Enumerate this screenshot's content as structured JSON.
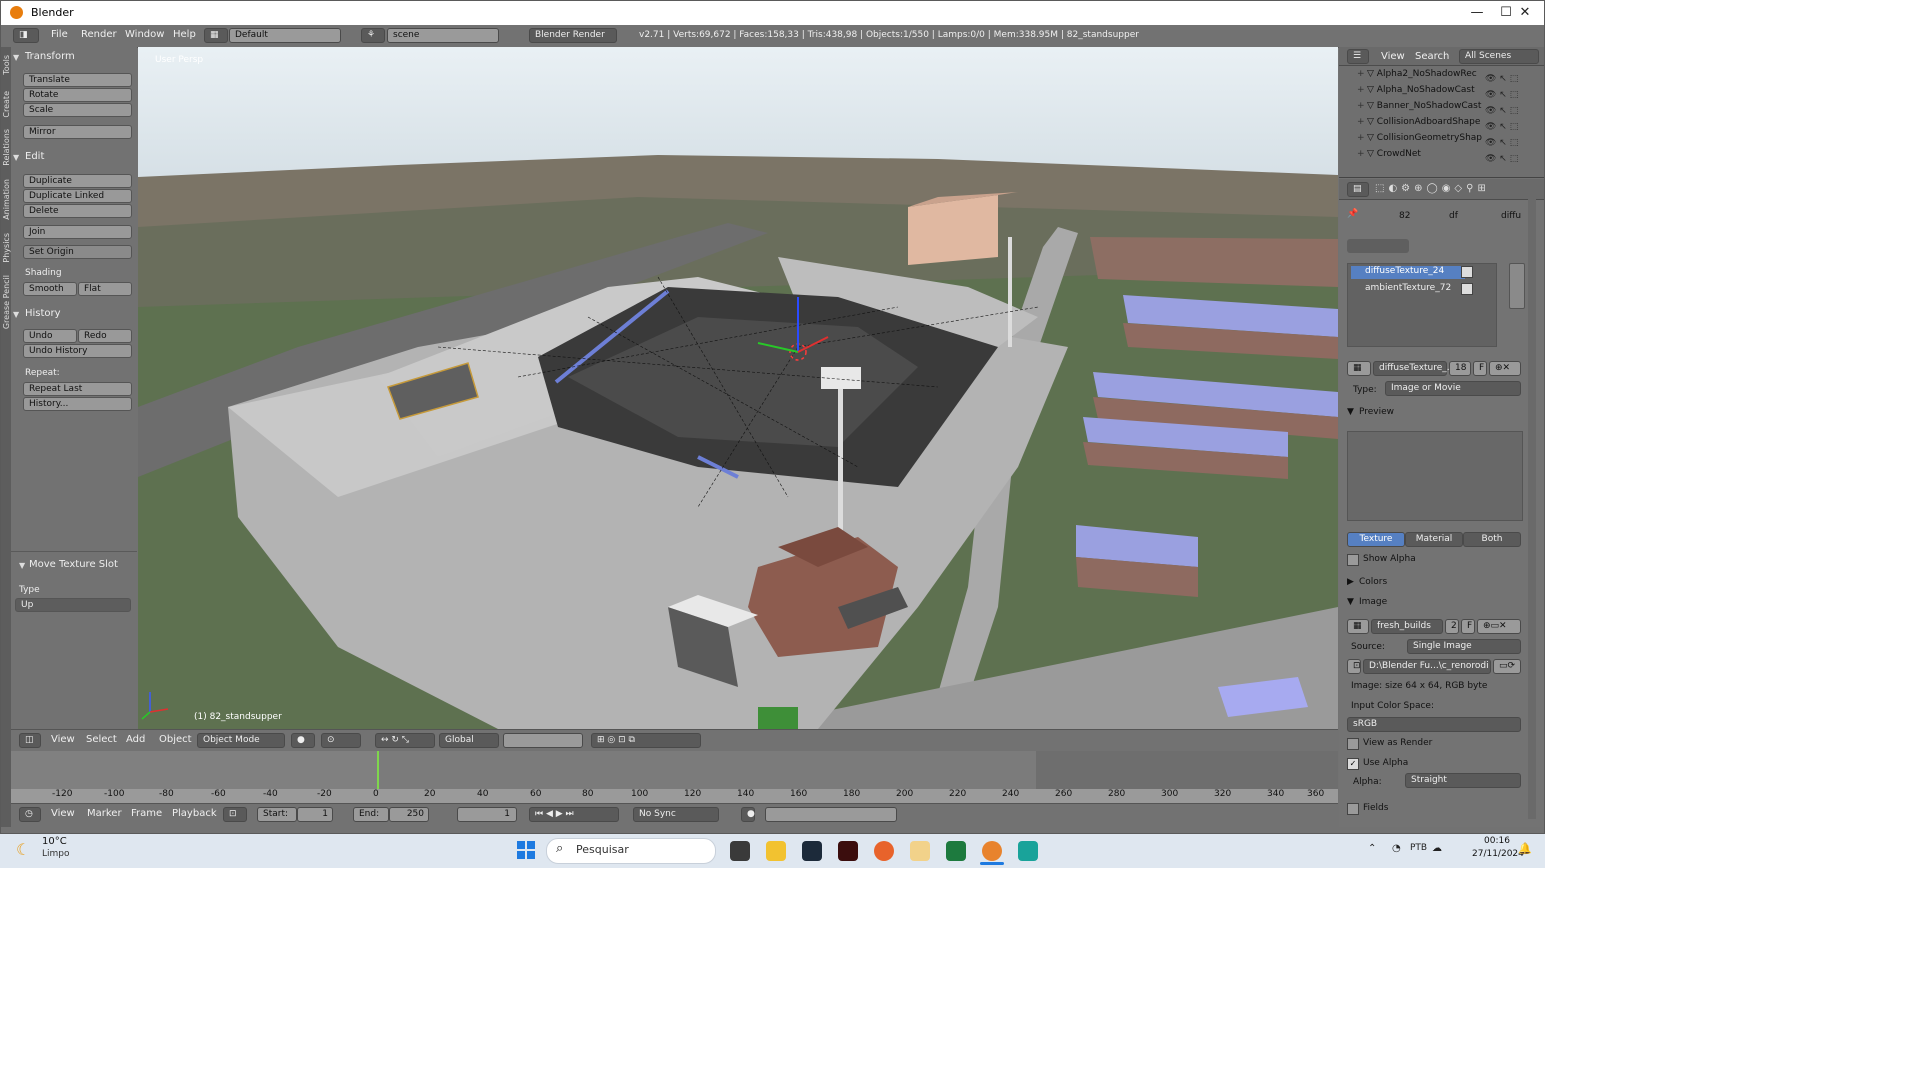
{
  "window": {
    "title": "Blender",
    "minimize": "—",
    "maximize": "☐",
    "close": "✕"
  },
  "menu": {
    "file": "File",
    "render": "Render",
    "window": "Window",
    "help": "Help"
  },
  "layout": {
    "screen": "Default",
    "scene": "scene",
    "engine": "Blender Render"
  },
  "stats": "v2.71 | Verts:69,672 | Faces:158,33 | Tris:438,98 | Objects:1/550 | Lamps:0/0 | Mem:338.95M | 82_standsupper",
  "toolshelf": {
    "tabs": [
      "Tools",
      "Create",
      "Relations",
      "Animation",
      "Physics",
      "Grease Pencil"
    ],
    "transform_header": "Transform",
    "translate": "Translate",
    "rotate": "Rotate",
    "scale": "Scale",
    "mirror": "Mirror",
    "edit_header": "Edit",
    "duplicate": "Duplicate",
    "duplicate_linked": "Duplicate Linked",
    "delete": "Delete",
    "join": "Join",
    "set_origin": "Set Origin",
    "shading_label": "Shading",
    "smooth": "Smooth",
    "flat": "Flat",
    "history_header": "History",
    "undo": "Undo",
    "redo": "Redo",
    "undo_history": "Undo History",
    "repeat_label": "Repeat:",
    "repeat_last": "Repeat Last",
    "history_btn": "History..."
  },
  "operator": {
    "header": "Move Texture Slot",
    "type_label": "Type",
    "type_value": "Up"
  },
  "viewport": {
    "view_label": "User Persp",
    "object_label": "(1) 82_standsupper"
  },
  "viewheader": {
    "view": "View",
    "select": "Select",
    "add": "Add",
    "object": "Object",
    "mode": "Object Mode",
    "orientation": "Global"
  },
  "timeline": {
    "ticks": [
      "-120",
      "-100",
      "-80",
      "-60",
      "-40",
      "-20",
      "0",
      "20",
      "40",
      "60",
      "80",
      "100",
      "120",
      "140",
      "160",
      "180",
      "200",
      "220",
      "240",
      "260",
      "280",
      "300",
      "320",
      "340",
      "360"
    ],
    "menu": {
      "view": "View",
      "marker": "Marker",
      "frame": "Frame",
      "playback": "Playback"
    },
    "start_label": "Start:",
    "start_value": "1",
    "end_label": "End:",
    "end_value": "250",
    "current": "1",
    "sync": "No Sync"
  },
  "outliner": {
    "view": "View",
    "search": "Search",
    "scenes": "All Scenes",
    "items": [
      "Alpha2_NoShadowRec",
      "Alpha_NoShadowCast",
      "Banner_NoShadowCast",
      "CollisionAdboardShape",
      "CollisionGeometryShap",
      "CrowdNet"
    ]
  },
  "props": {
    "crumb1": "82",
    "crumb2": "df",
    "crumb3": "diffu",
    "slots": [
      "diffuseTexture_24",
      "ambientTexture_72"
    ],
    "texname": "diffuseTexture_...",
    "users": "18",
    "f_label": "F",
    "type_label": "Type:",
    "type_value": "Image or Movie",
    "preview_header": "Preview",
    "tab_texture": "Texture",
    "tab_material": "Material",
    "tab_both": "Both",
    "show_alpha": "Show Alpha",
    "colors_header": "Colors",
    "image_header": "Image",
    "image_name": "fresh_builds",
    "image_users": "2",
    "image_f": "F",
    "source_label": "Source:",
    "source_value": "Single Image",
    "path": "D:\\Blender Fu...\\c_renorodi",
    "image_size": "Image: size 64 x 64, RGB byte",
    "color_space_label": "Input Color Space:",
    "color_space": "sRGB",
    "view_as_render": "View as Render",
    "use_alpha": "Use Alpha",
    "alpha_label": "Alpha:",
    "alpha_value": "Straight",
    "fields": "Fields"
  },
  "taskbar": {
    "weather_temp": "10°C",
    "weather_desc": "Limpo",
    "search": "Pesquisar",
    "lang": "PTB",
    "time": "00:16",
    "date": "27/11/2024"
  },
  "colors": {
    "accent_blue": "#5680c2",
    "selection_orange": "#d9ad3b",
    "viewport_sky": "#e4edf3"
  }
}
